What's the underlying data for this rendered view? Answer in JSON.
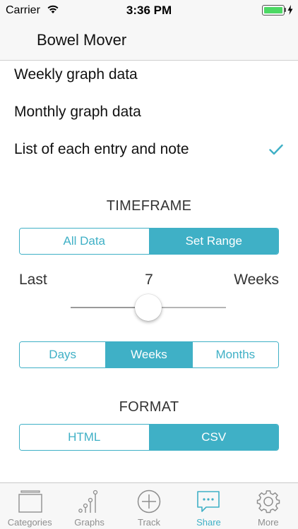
{
  "status_bar": {
    "carrier": "Carrier",
    "time": "3:36 PM",
    "battery_level": 1.0
  },
  "header": {
    "title": "Bowel Mover"
  },
  "options": [
    {
      "label": "Weekly graph data",
      "checked": false
    },
    {
      "label": "Monthly graph data",
      "checked": false
    },
    {
      "label": "List of each entry and note",
      "checked": true
    }
  ],
  "timeframe": {
    "title": "TIMEFRAME",
    "mode_segments": [
      {
        "label": "All Data",
        "selected": false
      },
      {
        "label": "Set Range",
        "selected": true
      }
    ],
    "range_prefix": "Last",
    "range_value": "7",
    "range_unit": "Weeks",
    "slider_fraction": 0.5,
    "unit_segments": [
      {
        "label": "Days",
        "selected": false
      },
      {
        "label": "Weeks",
        "selected": true
      },
      {
        "label": "Months",
        "selected": false
      }
    ]
  },
  "format": {
    "title": "FORMAT",
    "segments": [
      {
        "label": "HTML",
        "selected": false
      },
      {
        "label": "CSV",
        "selected": true
      }
    ]
  },
  "tab_bar": {
    "tabs": [
      {
        "label": "Categories",
        "icon": "categories-icon",
        "active": false
      },
      {
        "label": "Graphs",
        "icon": "graphs-icon",
        "active": false
      },
      {
        "label": "Track",
        "icon": "plus-circle-icon",
        "active": false
      },
      {
        "label": "Share",
        "icon": "chat-bubble-icon",
        "active": true
      },
      {
        "label": "More",
        "icon": "gear-icon",
        "active": false
      }
    ]
  },
  "colors": {
    "accent": "#3fb0c6",
    "battery": "#4cd964",
    "inactive": "#8e8e8e"
  }
}
